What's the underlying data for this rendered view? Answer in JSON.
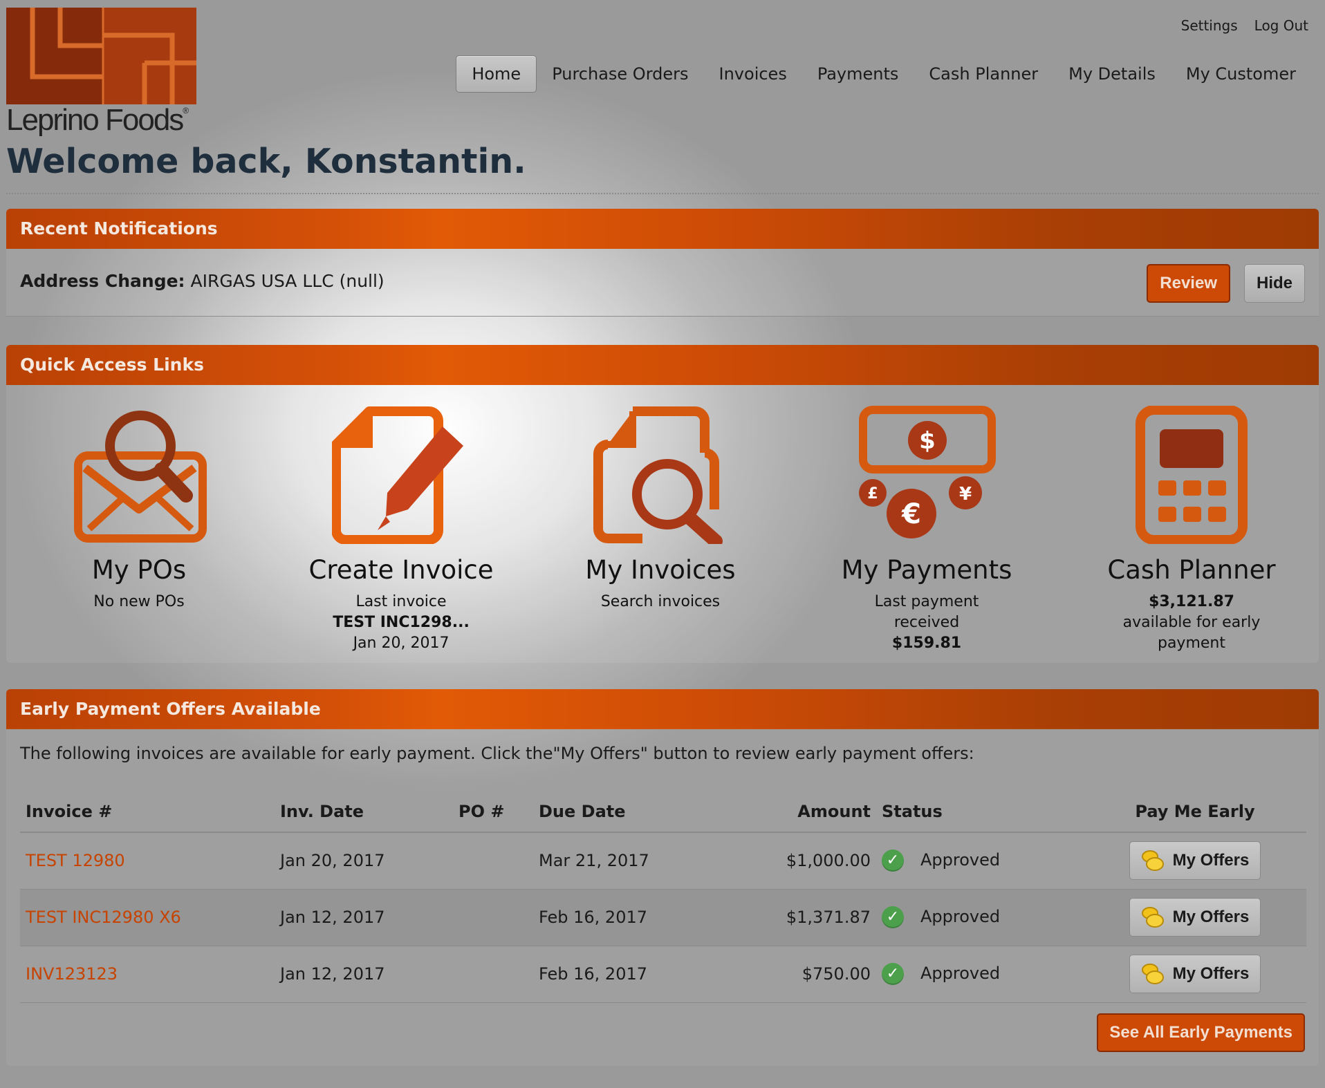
{
  "brand": {
    "name": "Leprino Foods",
    "primary_color": "#cc4a06",
    "logo_color": "#a83a10"
  },
  "top_links": {
    "settings": "Settings",
    "logout": "Log Out"
  },
  "nav": {
    "items": [
      {
        "label": "Home",
        "active": true
      },
      {
        "label": "Purchase Orders"
      },
      {
        "label": "Invoices"
      },
      {
        "label": "Payments"
      },
      {
        "label": "Cash Planner"
      },
      {
        "label": "My Details"
      },
      {
        "label": "My Customer"
      }
    ]
  },
  "welcome": "Welcome back, Konstantin.",
  "notifications": {
    "title": "Recent Notifications",
    "item_label": "Address Change:",
    "item_value": "AIRGAS USA LLC (null)",
    "review_label": "Review",
    "hide_label": "Hide"
  },
  "quick_links": {
    "title": "Quick Access Links",
    "items": [
      {
        "icon": "envelope-search-icon",
        "title": "My POs",
        "line1": "No new POs"
      },
      {
        "icon": "document-pencil-icon",
        "title": "Create Invoice",
        "line1": "Last invoice",
        "bold": "TEST INC1298...",
        "line2": "Jan 20, 2017"
      },
      {
        "icon": "document-search-icon",
        "title": "My Invoices",
        "line1": "Search invoices"
      },
      {
        "icon": "currency-icon",
        "title": "My Payments",
        "line1": "Last payment",
        "line1b": "received",
        "bold": "$159.81"
      },
      {
        "icon": "calculator-icon",
        "title": "Cash Planner",
        "bold": "$3,121.87",
        "line1": "available for early",
        "line2": "payment"
      }
    ]
  },
  "early_payment": {
    "title": "Early Payment Offers Available",
    "intro": "The following invoices are available for early payment. Click the\"My Offers\" button to review early payment offers:",
    "columns": [
      "Invoice #",
      "Inv. Date",
      "PO #",
      "Due Date",
      "Amount",
      "Status",
      "Pay Me Early"
    ],
    "rows": [
      {
        "invoice": "TEST 12980",
        "inv_date": "Jan 20, 2017",
        "po": "",
        "due_date": "Mar 21, 2017",
        "amount": "$1,000.00",
        "status": "Approved",
        "action": "My Offers"
      },
      {
        "invoice": "TEST INC12980 X6",
        "inv_date": "Jan 12, 2017",
        "po": "",
        "due_date": "Feb 16, 2017",
        "amount": "$1,371.87",
        "status": "Approved",
        "action": "My Offers"
      },
      {
        "invoice": "INV123123",
        "inv_date": "Jan 12, 2017",
        "po": "",
        "due_date": "Feb 16, 2017",
        "amount": "$750.00",
        "status": "Approved",
        "action": "My Offers"
      }
    ],
    "see_all_label": "See All Early Payments"
  }
}
